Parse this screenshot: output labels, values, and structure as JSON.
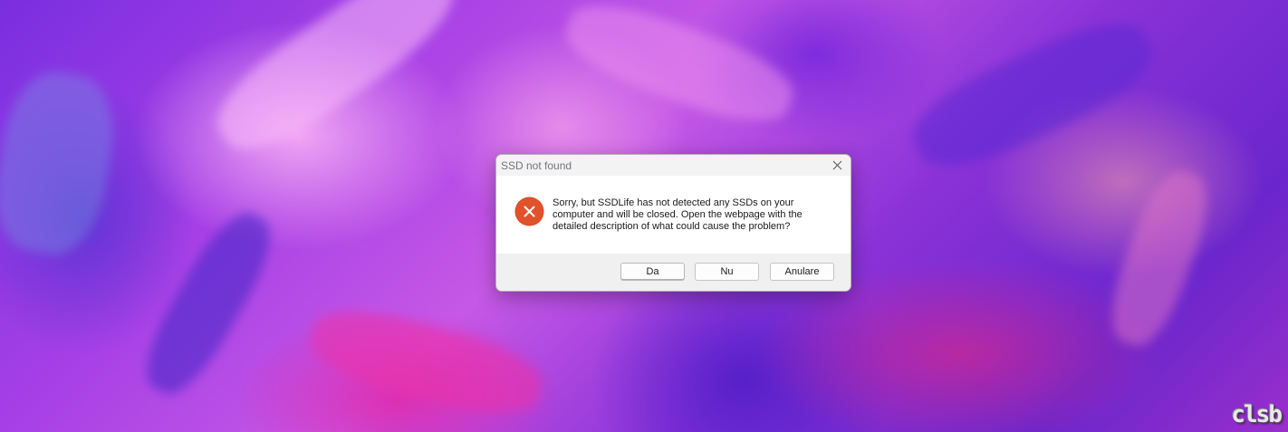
{
  "dialog": {
    "title": "SSD not found",
    "message": "Sorry, but SSDLife has not detected any SSDs on your computer and will be closed. Open the webpage with the detailed description of what could cause the problem?",
    "buttons": {
      "yes": "Da",
      "no": "Nu",
      "cancel": "Anulare"
    },
    "icons": {
      "status": "error-icon",
      "close": "close-icon"
    },
    "colors": {
      "error_icon": "#d9481f"
    }
  },
  "watermark": {
    "text": "clsb"
  }
}
